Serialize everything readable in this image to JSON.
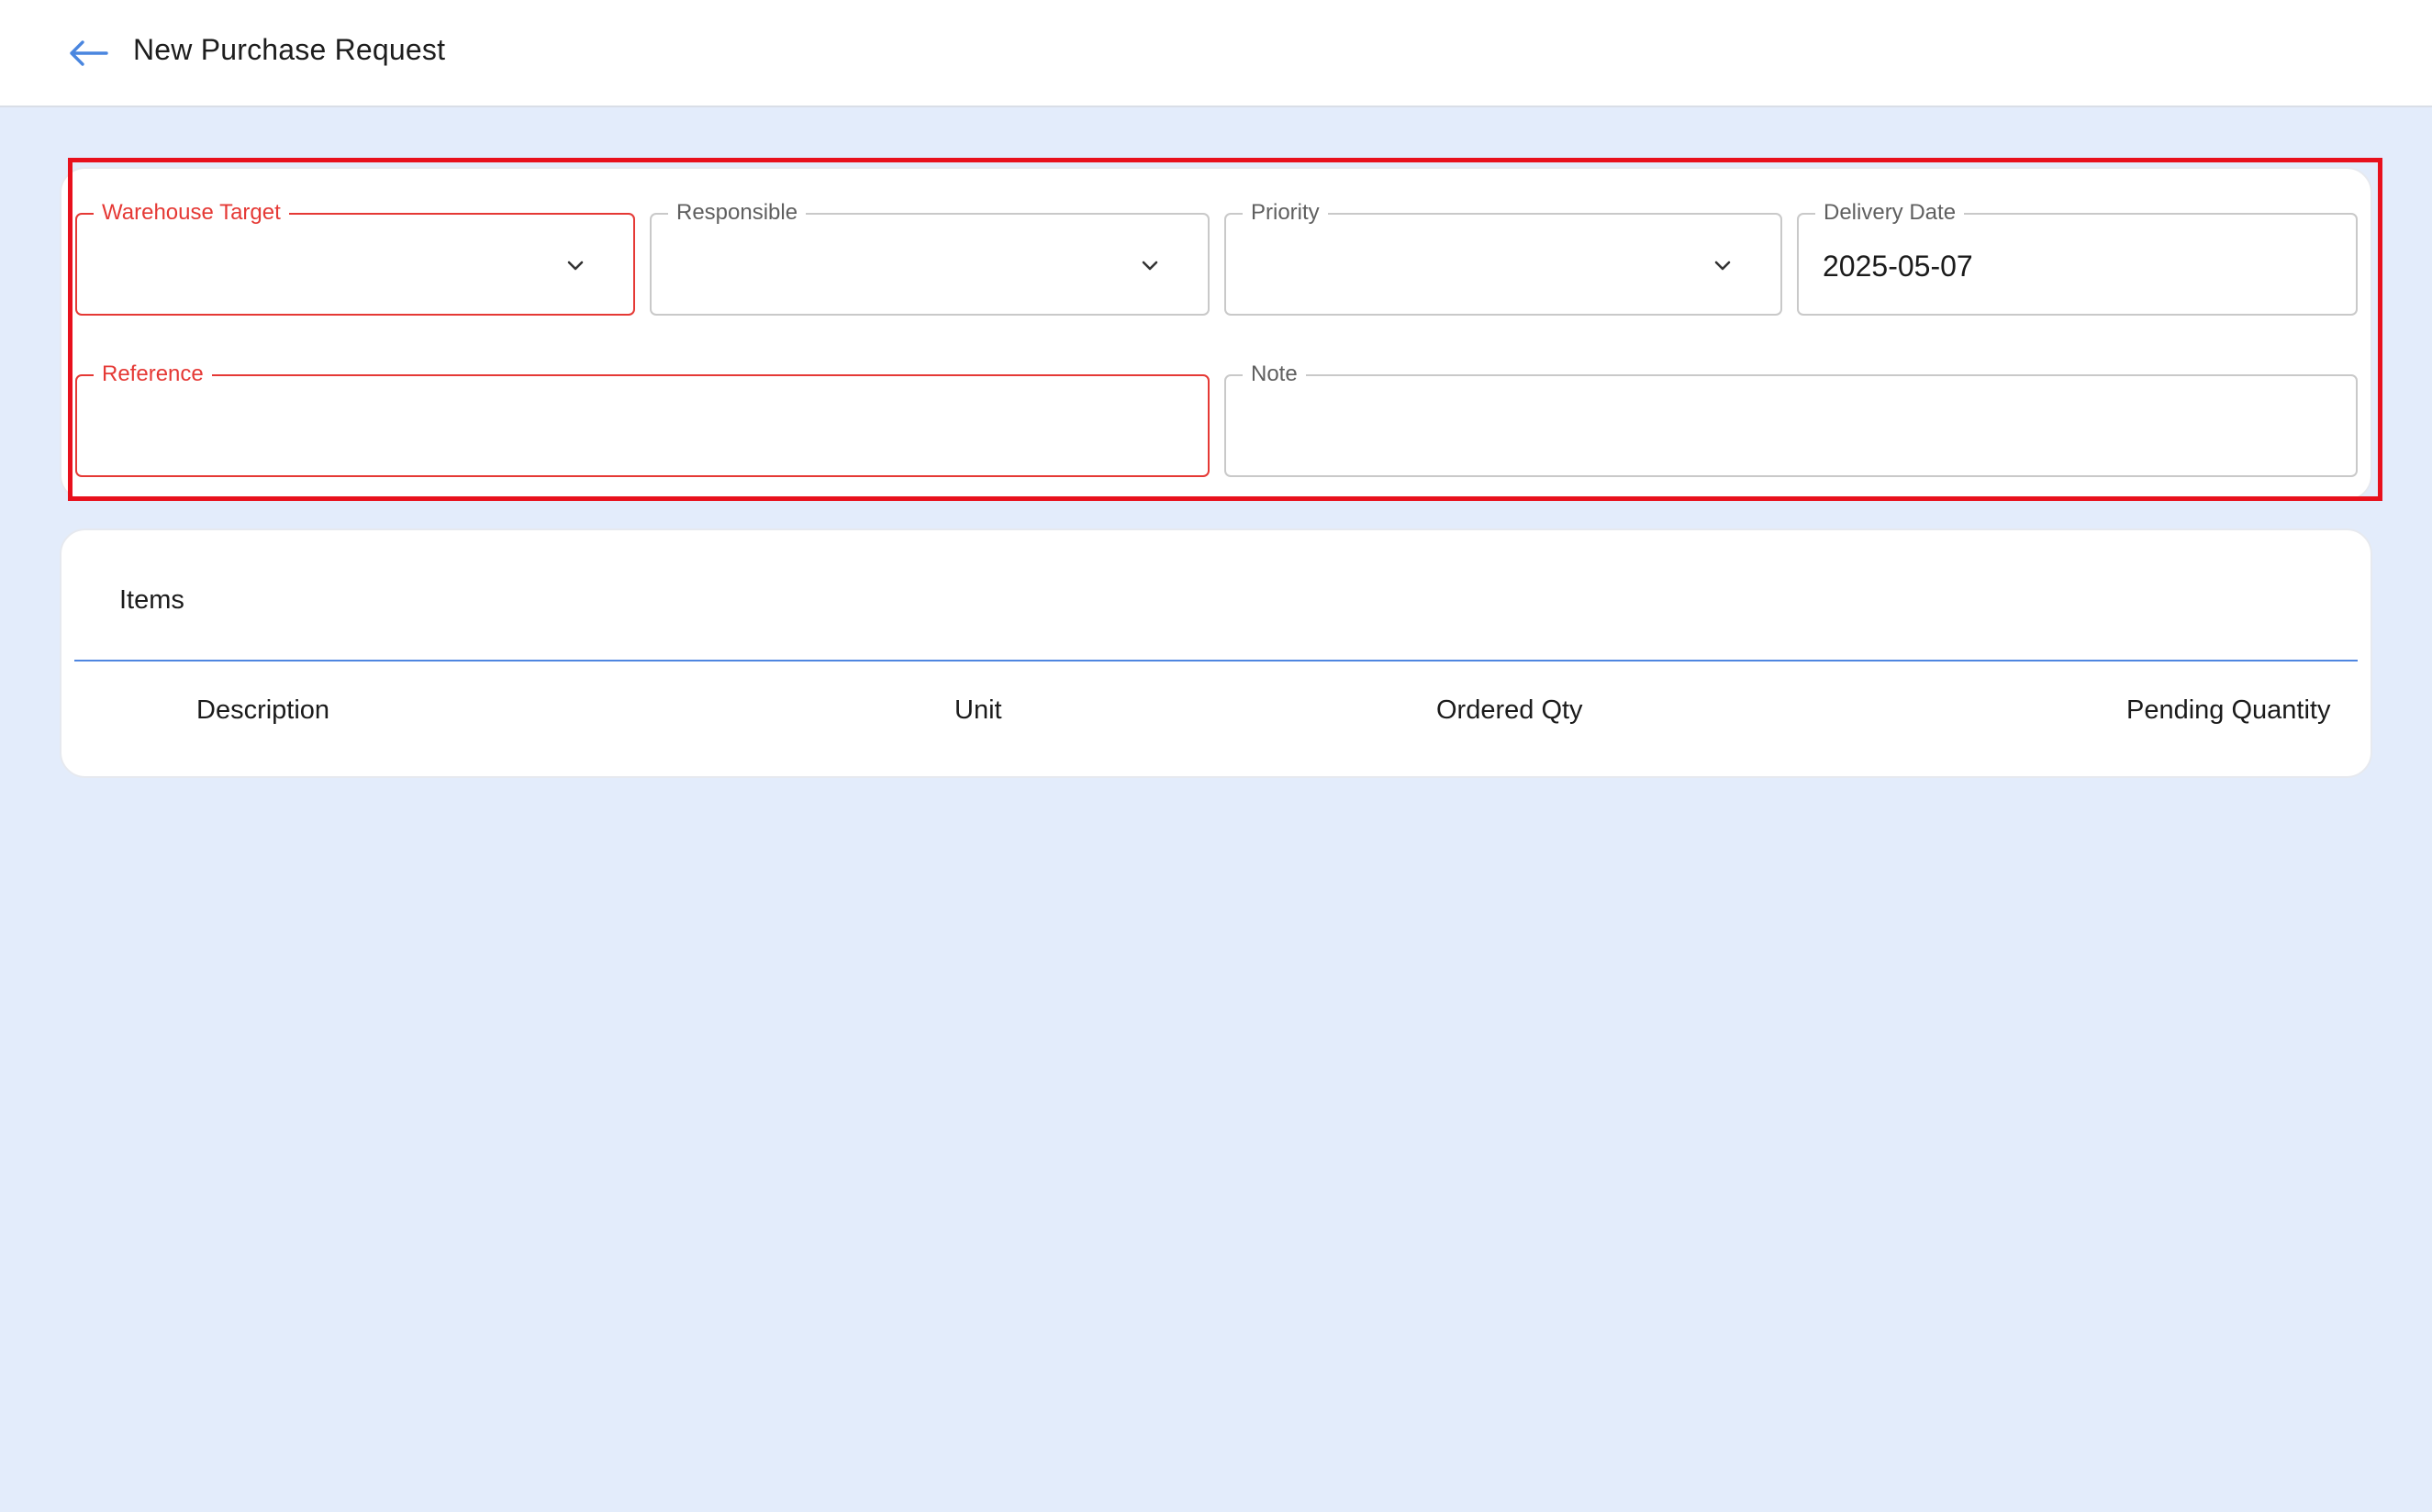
{
  "header": {
    "title": "New Purchase Request",
    "back_icon": "arrow-left-icon",
    "back_icon_color": "#4a86df"
  },
  "form": {
    "warehouse_target": {
      "label": "Warehouse Target",
      "value": "",
      "state": "error"
    },
    "responsible": {
      "label": "Responsible",
      "value": ""
    },
    "priority": {
      "label": "Priority",
      "value": ""
    },
    "delivery_date": {
      "label": "Delivery Date",
      "value": "2025-05-07"
    },
    "reference": {
      "label": "Reference",
      "value": "",
      "state": "error"
    },
    "note": {
      "label": "Note",
      "value": ""
    }
  },
  "items": {
    "title": "Items",
    "columns": [
      "Description",
      "Unit",
      "Ordered Qty",
      "Pending Quantity"
    ],
    "rows": []
  },
  "colors": {
    "background": "#e3ecfb",
    "error": "#e53935",
    "accent": "#4f86e0",
    "highlight": "#e8101c"
  }
}
